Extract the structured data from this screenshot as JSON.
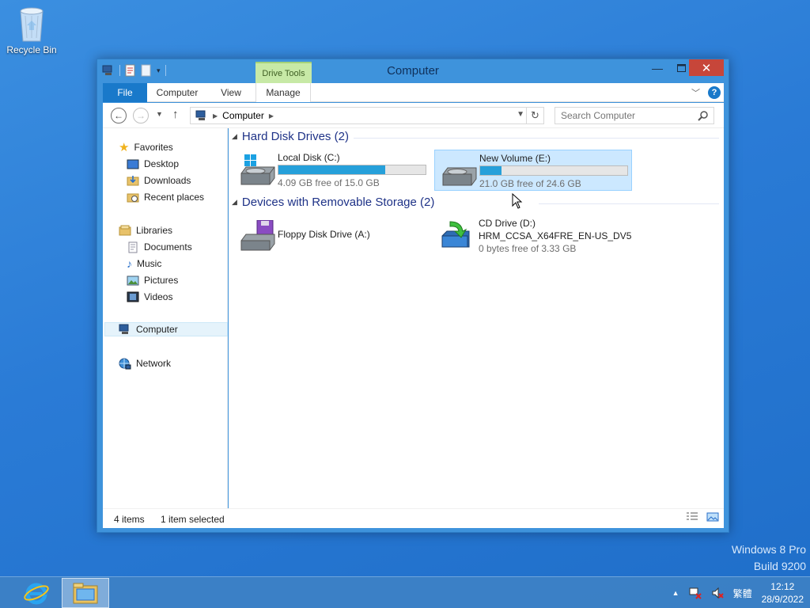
{
  "desktop": {
    "recycle_bin_label": "Recycle Bin"
  },
  "watermark": {
    "line1": "Windows 8 Pro",
    "line2": "Build 9200"
  },
  "window": {
    "title": "Computer",
    "context_tab_group": "Drive Tools",
    "ribbon_tabs": [
      "File",
      "Computer",
      "View",
      "Manage"
    ],
    "address_path": "Computer",
    "search_placeholder": "Search Computer"
  },
  "nav_pane": {
    "favorites": "Favorites",
    "desktop": "Desktop",
    "downloads": "Downloads",
    "recent_places": "Recent places",
    "libraries": "Libraries",
    "documents": "Documents",
    "music": "Music",
    "pictures": "Pictures",
    "videos": "Videos",
    "computer": "Computer",
    "network": "Network"
  },
  "content": {
    "groups": [
      {
        "title": "Hard Disk Drives (2)",
        "drives": [
          {
            "name": "Local Disk (C:)",
            "free_text": "4.09 GB free of 15.0 GB",
            "used_fraction": 0.727,
            "selected": false
          },
          {
            "name": "New Volume (E:)",
            "free_text": "21.0 GB free of 24.6 GB",
            "used_fraction": 0.146,
            "selected": true
          }
        ]
      },
      {
        "title": "Devices with Removable Storage (2)",
        "drives": [
          {
            "name": "Floppy Disk Drive (A:)"
          },
          {
            "name": "CD Drive (D:)",
            "label": "HRM_CCSA_X64FRE_EN-US_DV5",
            "free_text": "0 bytes free of 3.33 GB"
          }
        ]
      }
    ]
  },
  "statusbar": {
    "item_count": "4 items",
    "selection": "1 item selected"
  },
  "taskbar": {
    "ime_label": "繁體",
    "time": "12:12",
    "date": "28/9/2022"
  },
  "colors": {
    "accent": "#1979ca",
    "usage_bar": "#26a0da",
    "selection_bg": "#cce8ff",
    "close_button": "#c7463a",
    "context_tab": "#c7e9a6"
  }
}
